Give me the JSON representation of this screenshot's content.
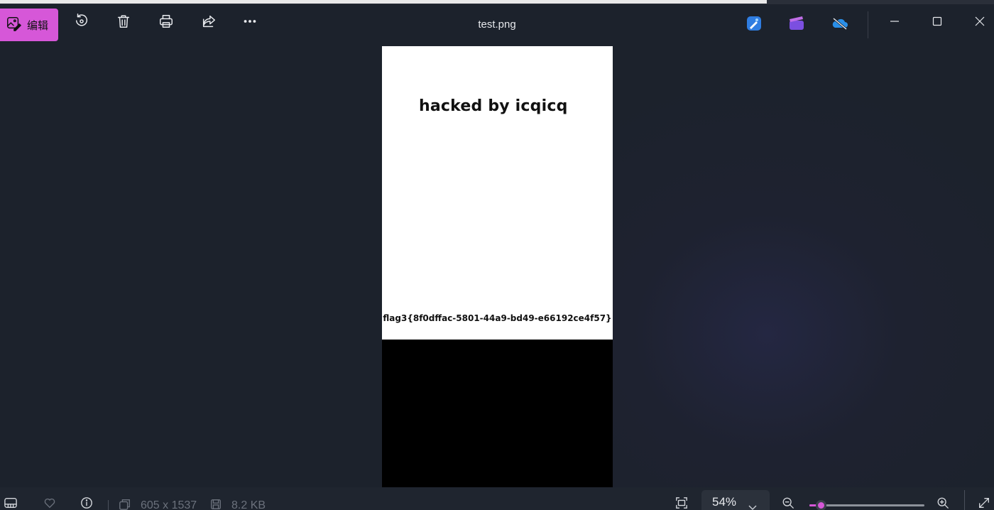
{
  "window": {
    "title": "test.png"
  },
  "toolbar": {
    "edit_label": "编辑",
    "accent_color": "#d657d8",
    "icons": [
      "edit-image-icon",
      "rotate-icon",
      "delete-icon",
      "print-icon",
      "share-icon",
      "more-icon"
    ],
    "app_icons": [
      "designer-icon",
      "clipchamp-icon",
      "onedrive-icon"
    ]
  },
  "image": {
    "heading": "hacked by icqicq",
    "flag": "flag3{8f0dffac-5801-44a9-bd49-e66192ce4f57}"
  },
  "statusbar": {
    "dimensions": "605 x 1537",
    "file_size": "8.2 KB",
    "zoom": "54%",
    "zoom_level": 0.1
  }
}
